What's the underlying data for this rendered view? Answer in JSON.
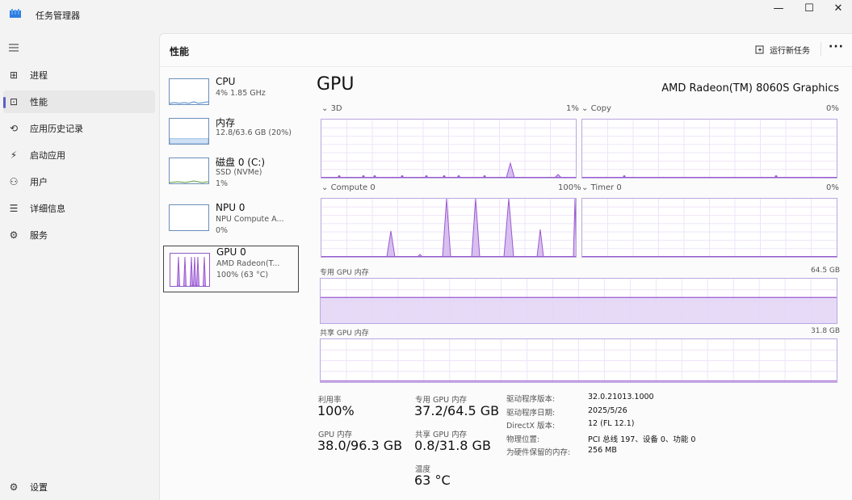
{
  "app": {
    "title": "任务管理器",
    "icon": "task-manager-icon"
  },
  "window_controls": {
    "minimize": "—",
    "maximize": "☐",
    "close": "✕"
  },
  "nav": {
    "items": [
      {
        "label": "进程",
        "icon": "processes-icon",
        "glyph": "⊞"
      },
      {
        "label": "性能",
        "icon": "performance-icon",
        "glyph": "⊡",
        "active": true
      },
      {
        "label": "应用历史记录",
        "icon": "history-icon",
        "glyph": "⟲"
      },
      {
        "label": "启动应用",
        "icon": "startup-icon",
        "glyph": "⚡"
      },
      {
        "label": "用户",
        "icon": "users-icon",
        "glyph": "⚇"
      },
      {
        "label": "详细信息",
        "icon": "details-icon",
        "glyph": "☰"
      },
      {
        "label": "服务",
        "icon": "services-icon",
        "glyph": "⚙"
      }
    ],
    "settings": {
      "label": "设置",
      "icon": "settings-icon",
      "glyph": "⚙"
    }
  },
  "header": {
    "title": "性能",
    "run_task": "运行新任务",
    "more": "···"
  },
  "devices": [
    {
      "name": "CPU",
      "sub1": "4% 1.85 GHz",
      "sub2": ""
    },
    {
      "name": "内存",
      "sub1": "12.8/63.6 GB (20%)",
      "sub2": ""
    },
    {
      "name": "磁盘 0 (C:)",
      "sub1": "SSD (NVMe)",
      "sub2": "1%"
    },
    {
      "name": "NPU 0",
      "sub1": "NPU Compute A...",
      "sub2": "0%"
    },
    {
      "name": "GPU 0",
      "sub1": "AMD Radeon(T...",
      "sub2": "100% (63 °C)",
      "selected": true
    }
  ],
  "gpu": {
    "title": "GPU",
    "model": "AMD Radeon(TM) 8060S Graphics",
    "graphs": {
      "g3d": {
        "label": "3D",
        "value": "1%"
      },
      "copy": {
        "label": "Copy",
        "value": "0%"
      },
      "compute": {
        "label": "Compute 0",
        "value": "100%"
      },
      "timer": {
        "label": "Timer 0",
        "value": "0%"
      },
      "dedicated": {
        "label": "专用 GPU 内存",
        "value": "64.5 GB",
        "fill_fraction": 0.577
      },
      "shared": {
        "label": "共享 GPU 内存",
        "value": "31.8 GB",
        "fill_fraction": 0.025
      }
    },
    "stats": {
      "util": {
        "label": "利用率",
        "value": "100%"
      },
      "dedicated": {
        "label": "专用 GPU 内存",
        "value": "37.2/64.5 GB"
      },
      "gpu_mem": {
        "label": "GPU 内存",
        "value": "38.0/96.3 GB"
      },
      "shared": {
        "label": "共享 GPU 内存",
        "value": "0.8/31.8 GB"
      },
      "temp": {
        "label": "温度",
        "value": "63 °C"
      }
    },
    "info": [
      {
        "k": "驱动程序版本:",
        "v": "32.0.21013.1000"
      },
      {
        "k": "驱动程序日期:",
        "v": "2025/5/26"
      },
      {
        "k": "DirectX 版本:",
        "v": "12 (FL 12.1)"
      },
      {
        "k": "物理位置:",
        "v": "PCI 总线 197、设备 0、功能 0"
      },
      {
        "k": "为硬件保留的内存:",
        "v": "256 MB"
      }
    ]
  },
  "colors": {
    "accent": "#5b5fc7",
    "gpu_line": "#9b59d0",
    "gpu_fill": "#e3d3f5",
    "cpu_line": "#4a86c7"
  }
}
